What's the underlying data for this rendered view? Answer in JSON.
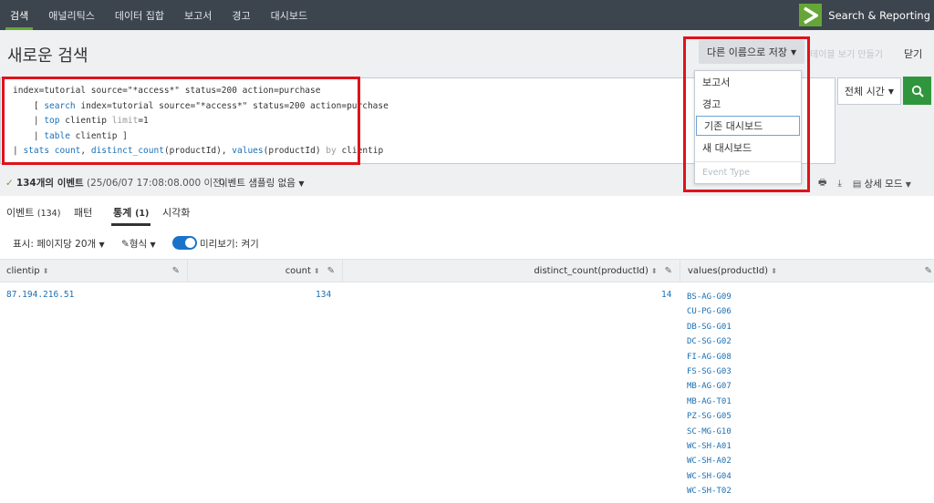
{
  "nav": {
    "items": [
      "검색",
      "애널리틱스",
      "데이터 집합",
      "보고서",
      "경고",
      "대시보드"
    ],
    "active_index": 0,
    "app_name": "Search & Reporting"
  },
  "header": {
    "title": "새로운 검색",
    "save_as_label": "다른 이름으로 저장",
    "create_table_label": "테이블 보기 만들기",
    "close_label": "닫기"
  },
  "search": {
    "query_lines": [
      {
        "parts": [
          {
            "t": "index=tutorial source=\"*access*\" status=200 action=purchase",
            "c": ""
          }
        ]
      },
      {
        "parts": [
          {
            "t": "    [ ",
            "c": ""
          },
          {
            "t": "search",
            "c": "kw"
          },
          {
            "t": " index=tutorial source=\"*access*\" status=200 action=purchase",
            "c": ""
          }
        ]
      },
      {
        "parts": [
          {
            "t": "    | ",
            "c": ""
          },
          {
            "t": "top",
            "c": "kw"
          },
          {
            "t": " clientip ",
            "c": ""
          },
          {
            "t": "limit",
            "c": "gr"
          },
          {
            "t": "=1",
            "c": ""
          }
        ]
      },
      {
        "parts": [
          {
            "t": "    | ",
            "c": ""
          },
          {
            "t": "table",
            "c": "kw"
          },
          {
            "t": " clientip ]",
            "c": ""
          }
        ]
      },
      {
        "parts": [
          {
            "t": "| ",
            "c": ""
          },
          {
            "t": "stats",
            "c": "kw"
          },
          {
            "t": " ",
            "c": ""
          },
          {
            "t": "count",
            "c": "fn"
          },
          {
            "t": ", ",
            "c": ""
          },
          {
            "t": "distinct_count",
            "c": "fn"
          },
          {
            "t": "(productId), ",
            "c": ""
          },
          {
            "t": "values",
            "c": "fn"
          },
          {
            "t": "(productId) ",
            "c": ""
          },
          {
            "t": "by",
            "c": "gr"
          },
          {
            "t": " clientip",
            "c": ""
          }
        ]
      }
    ],
    "time_range_label": "전체 시간",
    "search_icon": "search-icon"
  },
  "status": {
    "count_label": "134개의 이벤트",
    "time_label": "(25/06/07 17:08:08.000 이전)",
    "sampling_label": "이벤트 샘플링 없음",
    "mode_label": "상세 모드"
  },
  "tabs": [
    {
      "label": "이벤트",
      "count": "(134)"
    },
    {
      "label": "패턴",
      "count": ""
    },
    {
      "label": "통계",
      "count": "(1)"
    },
    {
      "label": "시각화",
      "count": ""
    }
  ],
  "active_tab_index": 2,
  "controls": {
    "per_page_label": "표시: 페이지당 20개",
    "format_label": "형식",
    "preview_label": "미리보기: 켜기"
  },
  "table": {
    "columns": [
      "clientip",
      "count",
      "distinct_count(productId)",
      "values(productId)"
    ],
    "row": {
      "clientip": "87.194.216.51",
      "count": "134",
      "distinct_count": "14",
      "values": [
        "BS-AG-G09",
        "CU-PG-G06",
        "DB-SG-G01",
        "DC-SG-G02",
        "FI-AG-G08",
        "FS-SG-G03",
        "MB-AG-G07",
        "MB-AG-T01",
        "PZ-SG-G05",
        "SC-MG-G10",
        "WC-SH-A01",
        "WC-SH-A02",
        "WC-SH-G04",
        "WC-SH-T02"
      ]
    }
  },
  "dropdown": {
    "items": [
      "보고서",
      "경고",
      "기존 대시보드",
      "새 대시보드"
    ],
    "focused_index": 2,
    "sub_item": "Event Type"
  },
  "colors": {
    "topbar": "#3c444d",
    "accent_green": "#65a637",
    "search_button": "#30963e",
    "link_blue": "#1a6fb5",
    "highlight_red": "#e0121a"
  }
}
